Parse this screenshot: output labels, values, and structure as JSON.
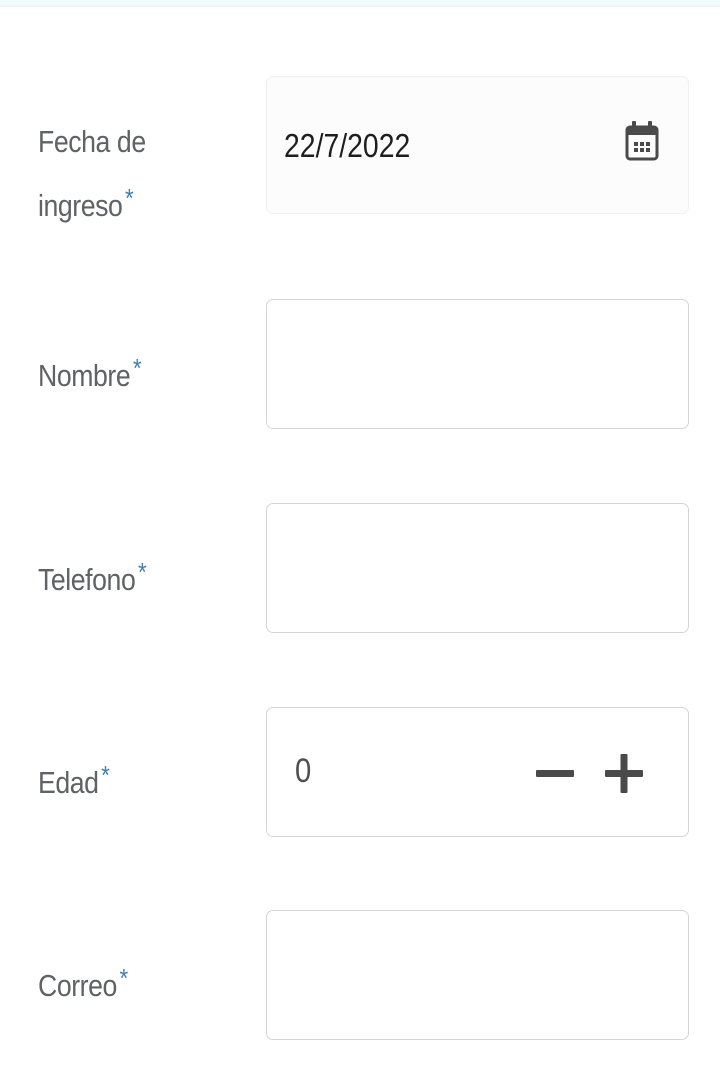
{
  "form": {
    "fields": [
      {
        "label_line1": "Fecha de",
        "label_line2": "ingreso",
        "required_mark": "*",
        "value": "22/7/2022",
        "icon": "calendar-icon"
      },
      {
        "label": "Nombre",
        "required_mark": "*",
        "value": ""
      },
      {
        "label": "Telefono",
        "required_mark": "*",
        "value": ""
      },
      {
        "label": "Edad",
        "required_mark": "*",
        "value": "0",
        "icons": [
          "minus-icon",
          "plus-icon"
        ]
      },
      {
        "label": "Correo",
        "required_mark": "*",
        "value": ""
      }
    ]
  },
  "colors": {
    "label": "#5f6266",
    "required": "#3f7fb3",
    "border": "#d4d6d8",
    "icon": "#4a4a4a"
  }
}
